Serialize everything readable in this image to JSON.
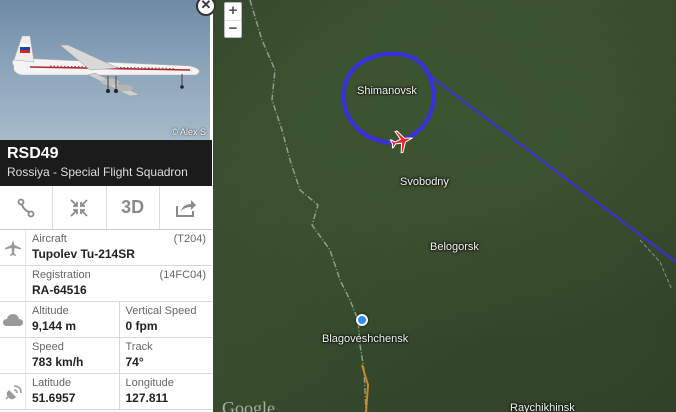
{
  "flight": {
    "photo_credit": "© Alex S",
    "callsign": "RSD49",
    "airline": "Rossiya - Special Flight Squadron"
  },
  "toolbar": {
    "threed_label": "3D"
  },
  "details": {
    "aircraft_label": "Aircraft",
    "aircraft_code": "(T204)",
    "aircraft_value": "Tupolev Tu-214SR",
    "registration_label": "Registration",
    "registration_code": "(14FC04)",
    "registration_value": "RA-64516",
    "altitude_label": "Altitude",
    "altitude_value": "9,144 m",
    "vspeed_label": "Vertical Speed",
    "vspeed_value": "0 fpm",
    "speed_label": "Speed",
    "speed_value": "783 km/h",
    "track_label": "Track",
    "track_value": "74°",
    "latitude_label": "Latitude",
    "latitude_value": "51.6957",
    "longitude_label": "Longitude",
    "longitude_value": "127.811"
  },
  "map": {
    "zoom_in": "+",
    "zoom_out": "−",
    "cities": {
      "shimanovsk": "Shimanovsk",
      "svobodny": "Svobodny",
      "belogorsk": "Belogorsk",
      "blagoveshchensk": "Blagoveshchensk",
      "raychikhinsk": "Raychikhinsk"
    },
    "watermark": "Google",
    "track_color": "#3a2fe0",
    "aircraft_color": "#e8252c"
  },
  "icons": {
    "route": "route-icon",
    "collapse": "collapse-icon",
    "share": "share-icon",
    "plane": "plane-icon",
    "cloud": "cloud-icon",
    "antenna": "antenna-icon",
    "close": "close-icon",
    "zoom_in": "plus-icon",
    "zoom_out": "minus-icon",
    "location_pin": "location-pin-icon"
  }
}
